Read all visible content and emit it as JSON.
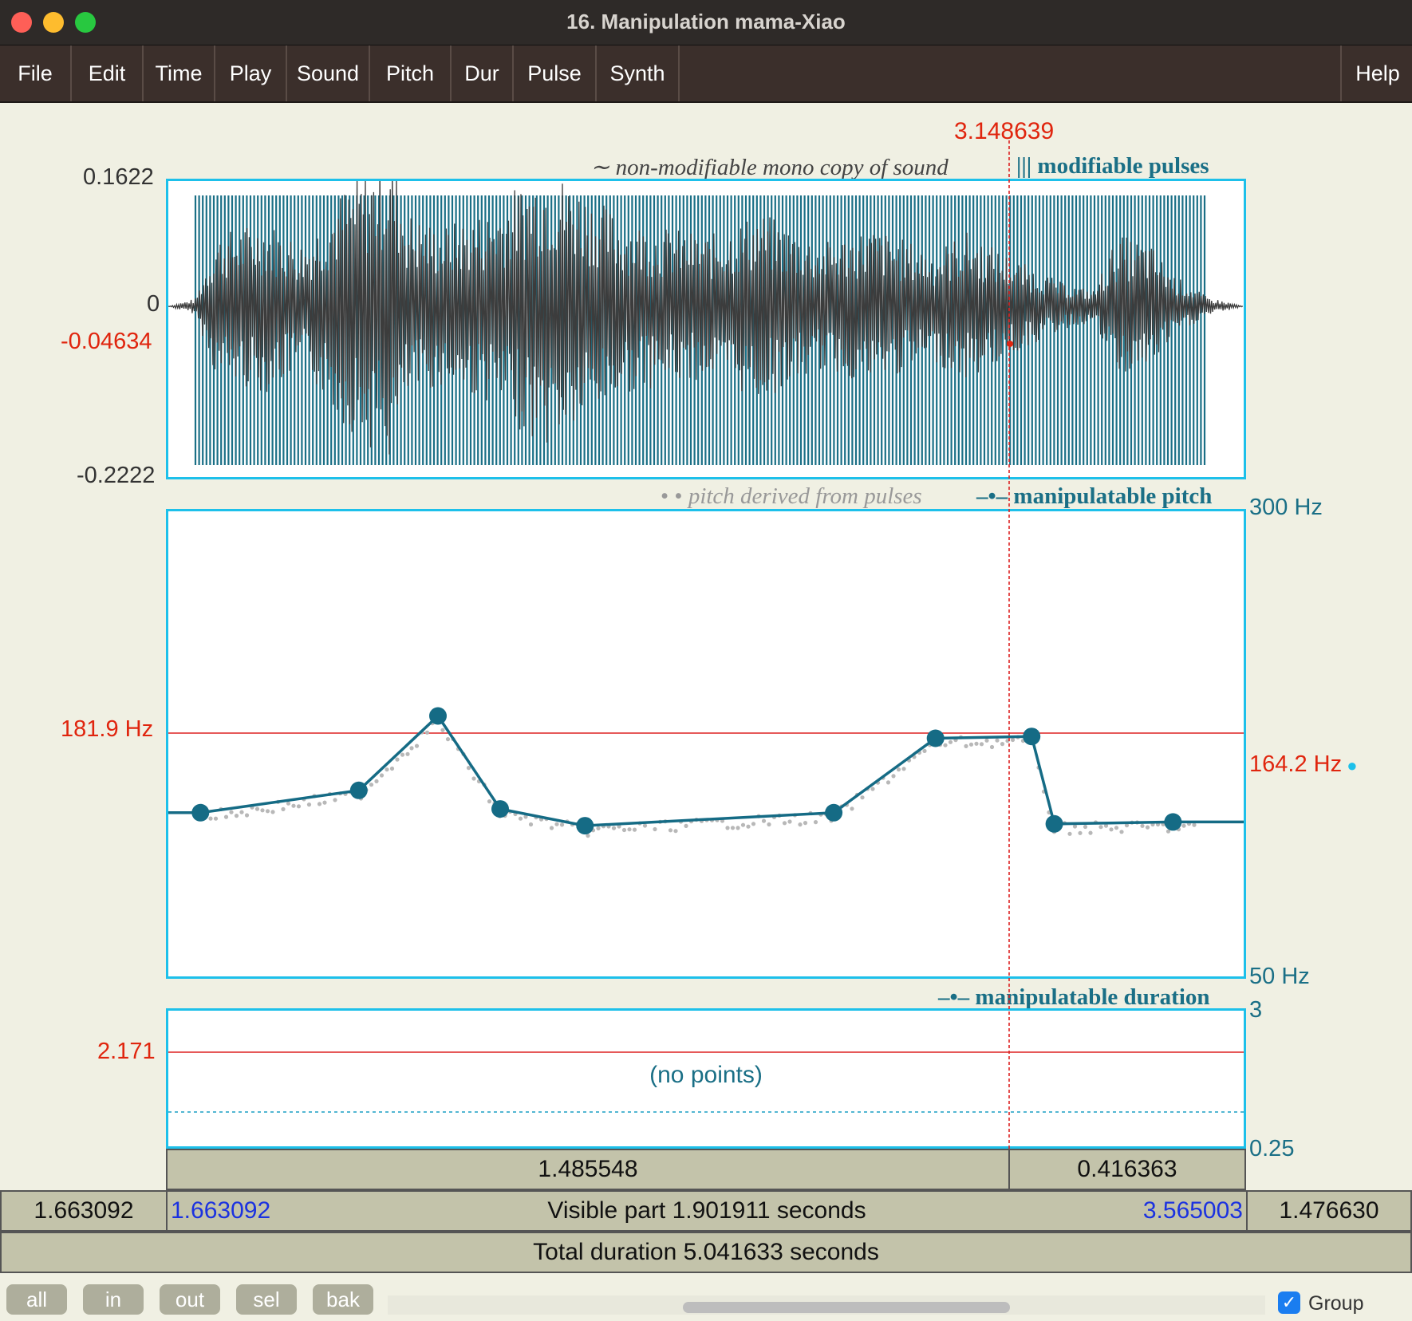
{
  "window": {
    "title": "16. Manipulation mama-Xiao"
  },
  "menu": {
    "items": [
      "File",
      "Edit",
      "Time",
      "Play",
      "Sound",
      "Pitch",
      "Dur",
      "Pulse",
      "Synth"
    ],
    "help": "Help"
  },
  "cursor": {
    "time": "3.148639"
  },
  "sound_panel": {
    "legend_sound": "non-modifiable mono copy of sound",
    "legend_pulses": "modifiable pulses",
    "y_max": "0.1622",
    "y_zero": "0",
    "y_cursor": "-0.04634",
    "y_min": "-0.2222"
  },
  "pitch_panel": {
    "legend_derived": "pitch derived from pulses",
    "legend_manip": "manipulatable pitch",
    "top_label": "300 Hz",
    "bottom_label": "50 Hz",
    "cursor_hz_left": "181.9 Hz",
    "cursor_hz_right": "164.2 Hz"
  },
  "duration_panel": {
    "legend": "manipulatable duration",
    "top_label": "3",
    "bottom_label": "0.25",
    "cursor_value": "2.171",
    "empty_text": "(no points)"
  },
  "time_bars": {
    "sel_left": "1.485548",
    "sel_right": "0.416363",
    "left_outside": "1.663092",
    "visible_start": "1.663092",
    "visible_text": "Visible part 1.901911 seconds",
    "visible_end": "3.565003",
    "right_outside": "1.476630",
    "total_text": "Total duration 5.041633 seconds"
  },
  "bottom_buttons": [
    "all",
    "in",
    "out",
    "sel",
    "bak"
  ],
  "group": {
    "label": "Group",
    "checked": true
  },
  "colors": {
    "accent": "#1dc0ea",
    "pulse": "#1a6f86",
    "cursor": "#e0250e",
    "bar": "#c3c3aa"
  },
  "chart_data": {
    "type": "line",
    "xlim": [
      1.663092,
      3.565003
    ],
    "ylim": [
      50,
      300
    ],
    "x": [
      1.72,
      2.0,
      2.14,
      2.25,
      2.4,
      2.84,
      3.02,
      3.19,
      3.23,
      3.44
    ],
    "values": [
      138,
      150,
      190,
      140,
      131,
      138,
      178,
      179,
      132,
      133
    ]
  }
}
